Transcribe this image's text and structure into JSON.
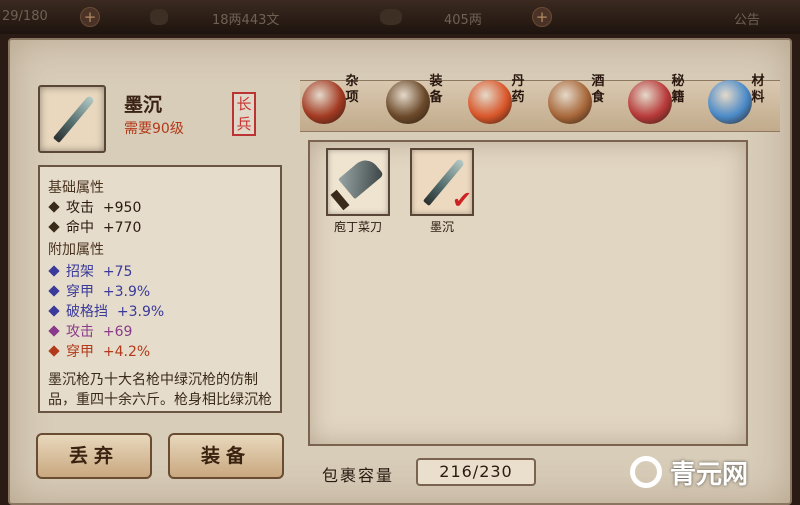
{
  "topbar": {
    "hp": "29/180",
    "currency1": "18两443文",
    "currency2": "405两",
    "notice": "公告",
    "icons": [
      "plus-icon",
      "skull-icon",
      "plus-icon",
      "coin-icon",
      "plus-icon"
    ]
  },
  "item": {
    "name": "墨沉",
    "requirement": "需要90级",
    "type_stamp": "长兵",
    "icon": "dagger-icon"
  },
  "tabs": [
    {
      "label": "杂项",
      "icon": "jar-icon",
      "color": "#a33a22"
    },
    {
      "label": "装备",
      "icon": "weapons-icon",
      "color": "#6b4a2a"
    },
    {
      "label": "丹药",
      "icon": "pills-icon",
      "color": "#d9562a"
    },
    {
      "label": "酒食",
      "icon": "wine-food-icon",
      "color": "#a8683a"
    },
    {
      "label": "秘籍",
      "icon": "books-icon",
      "color": "#b83a3a"
    },
    {
      "label": "材料",
      "icon": "crystal-icon",
      "color": "#4a8ac8"
    }
  ],
  "stats": {
    "base_title": "基础属性",
    "base": [
      {
        "label": "攻击",
        "value": "+950"
      },
      {
        "label": "命中",
        "value": "+770"
      }
    ],
    "extra_title": "附加属性",
    "extra": [
      {
        "label": "招架",
        "value": "+75",
        "color": "#3a3a9a"
      },
      {
        "label": "穿甲",
        "value": "+3.9%",
        "color": "#3a3a9a"
      },
      {
        "label": "破格挡",
        "value": "+3.9%",
        "color": "#3a3a9a"
      },
      {
        "label": "攻击",
        "value": "+69",
        "color": "#8a3a8a"
      },
      {
        "label": "穿甲",
        "value": "+4.2%",
        "color": "#b23a1a"
      }
    ],
    "description": "墨沉枪乃十大名枪中绿沉枪的仿制品，重四十余六斤。枪身相比绿沉枪墨色更重，握着时"
  },
  "bag": {
    "items": [
      {
        "label": "庖丁菜刀",
        "icon": "cleaver-icon"
      },
      {
        "label": "墨沉",
        "icon": "dagger-icon",
        "equipped": true
      }
    ]
  },
  "buttons": {
    "discard": "丢弃",
    "equip": "装备"
  },
  "capacity": {
    "label": "包裹容量",
    "value": "216/230"
  },
  "watermark": "青元网"
}
